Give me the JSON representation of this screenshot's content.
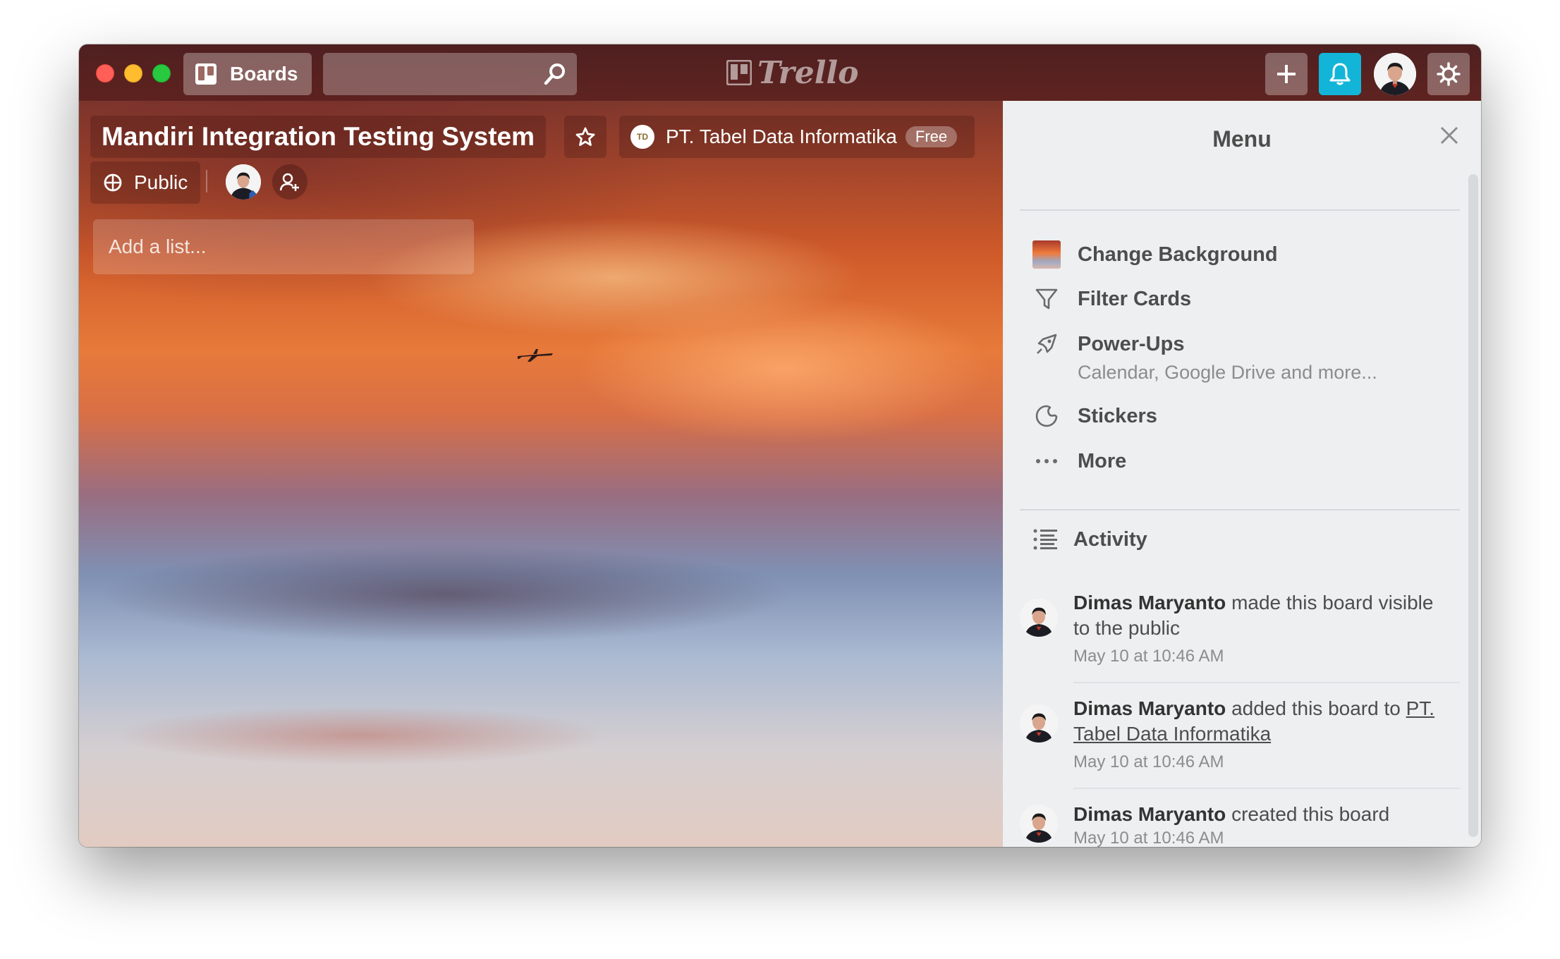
{
  "topbar": {
    "boards_label": "Boards",
    "search_placeholder": "",
    "logo_text": "Trello",
    "notification_color": "#12b5d8"
  },
  "board": {
    "title": "Mandiri Integration Testing System",
    "org_name": "PT. Tabel Data Informatika",
    "org_badge": "Free",
    "visibility": "Public",
    "add_list_placeholder": "Add a list..."
  },
  "menu": {
    "title": "Menu",
    "items": [
      {
        "label": "Change Background",
        "icon": "background-thumbnail-icon"
      },
      {
        "label": "Filter Cards",
        "icon": "filter-icon"
      },
      {
        "label": "Power-Ups",
        "icon": "rocket-icon",
        "sublabel": "Calendar, Google Drive and more..."
      },
      {
        "label": "Stickers",
        "icon": "sticker-icon"
      },
      {
        "label": "More",
        "icon": "more-icon"
      }
    ],
    "activity_title": "Activity",
    "activity": [
      {
        "user": "Dimas Maryanto",
        "text": " made this board visible to the public",
        "date": "May 10 at 10:46 AM"
      },
      {
        "user": "Dimas Maryanto",
        "text": " added this board to ",
        "link": "PT. Tabel Data Informatika",
        "date": "May 10 at 10:46 AM"
      },
      {
        "user": "Dimas Maryanto",
        "text": " created this board",
        "date": "May 10 at 10:46 AM"
      }
    ]
  }
}
